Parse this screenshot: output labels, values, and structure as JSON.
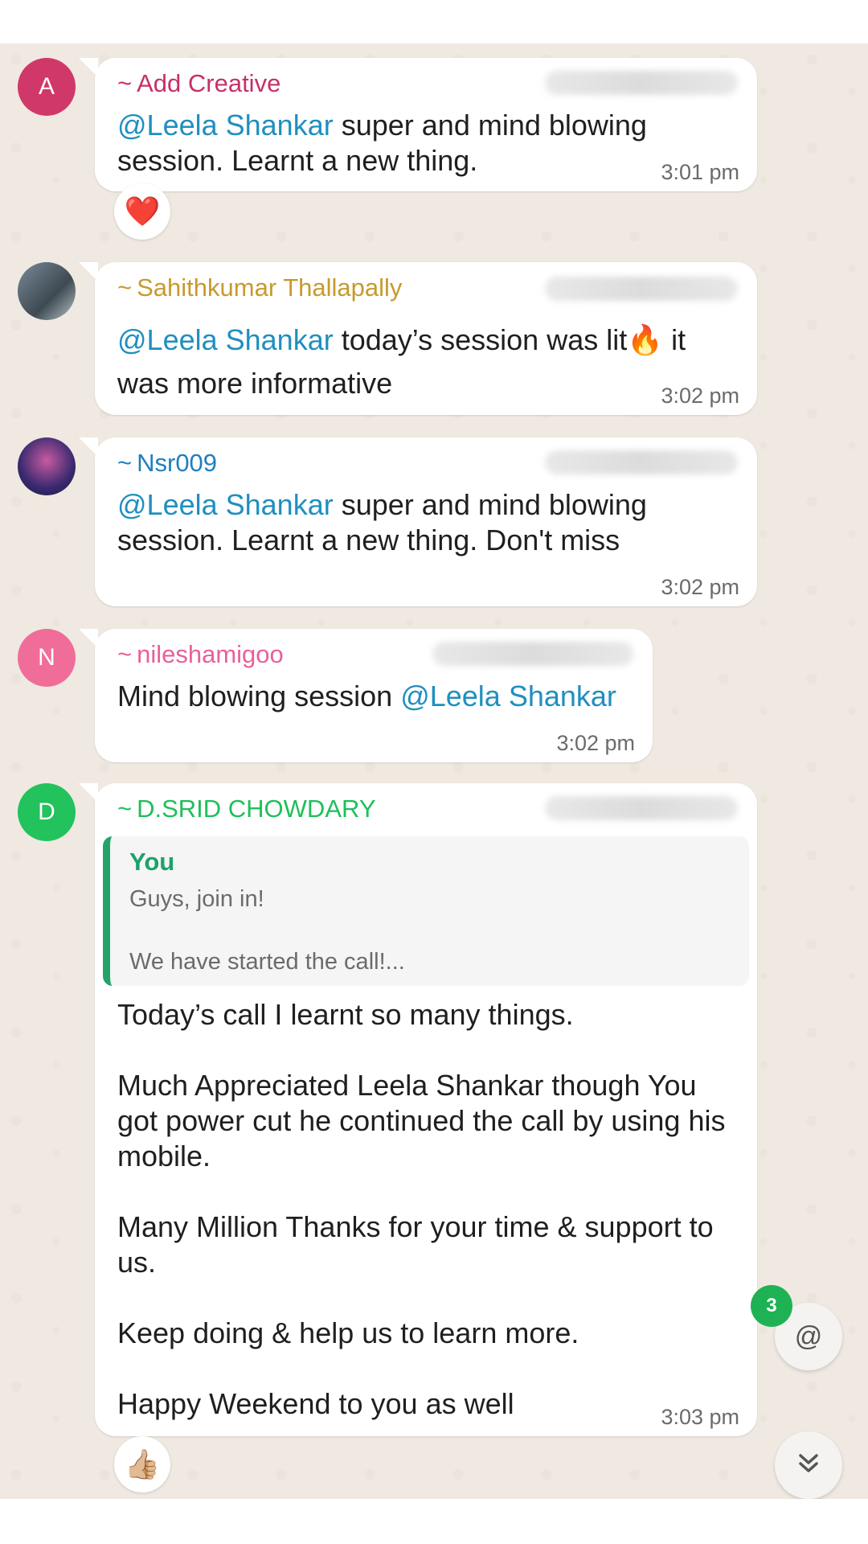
{
  "messages": [
    {
      "avatar_letter": "A",
      "sender": "Add Creative",
      "tilde": "~",
      "mention": "@Leela Shankar",
      "text": " super and mind blowing session. Learnt a new thing.",
      "time": "3:01 pm",
      "reaction": "❤️"
    },
    {
      "sender": "Sahithkumar Thallapally",
      "tilde": "~",
      "mention": "@Leela Shankar",
      "text_a": " today’s session was lit",
      "emoji": "🔥",
      "text_b": " it was more informative",
      "time": "3:02 pm"
    },
    {
      "sender": "Nsr009",
      "tilde": "~",
      "mention": "@Leela Shankar",
      "text": " super and mind blowing session. Learnt a new thing. Don't miss",
      "time": "3:02 pm"
    },
    {
      "avatar_letter": "N",
      "sender": "nileshamigoo",
      "tilde": "~",
      "text": "Mind blowing session ",
      "mention": "@Leela Shankar",
      "time": "3:02 pm"
    },
    {
      "avatar_letter": "D",
      "sender": "D.SRID CHOWDARY",
      "tilde": "~",
      "quote_author": "You",
      "quote_line1": "Guys, join in!",
      "quote_line2": "We have started the call!...",
      "body": "Today’s call I learnt so many things.\n\nMuch Appreciated Leela Shankar though You got power cut he continued the call by using his mobile.\n\nMany Million Thanks for your time & support to us.\n\nKeep doing & help us to learn more.\n\nHappy Weekend to you as well",
      "time": "3:03 pm",
      "reaction": "👍🏼"
    }
  ],
  "mentions_fab": {
    "symbol": "@",
    "badge_count": "3"
  },
  "scroll_fab": {
    "icon": "double-chevron-down-icon"
  },
  "colors": {
    "add_creative": "#c7306a",
    "sahithkumar": "#c79a2c",
    "nsr": "#1f7fbf",
    "nilesh": "#e8609a",
    "srid": "#1fbf5a",
    "mention": "#1f8fbf"
  }
}
